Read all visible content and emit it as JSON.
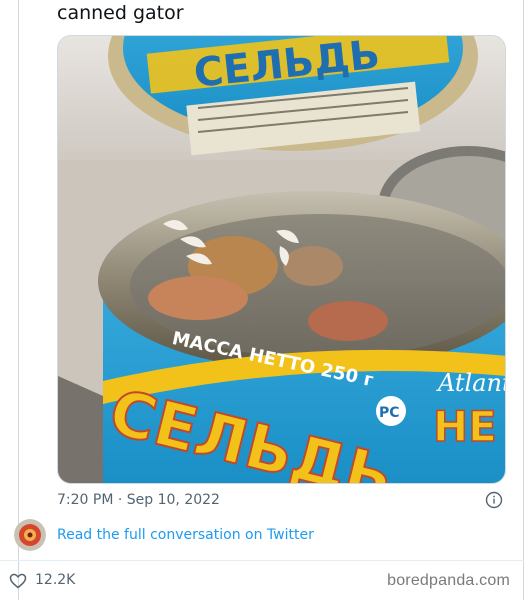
{
  "tweet": {
    "text": "canned gator",
    "timestamp": "7:20 PM · Sep 10, 2022",
    "conversation_link": "Read the full conversation on Twitter",
    "like_count": "12.2K"
  },
  "media": {
    "description_icon": "photo",
    "can_label_top": "СЕЛЬДЬ",
    "can_label_bottom": "СЕЛЬДЬ",
    "mass_label": "МАССА НЕТТО 250 г",
    "brand_right": "Atlant",
    "brand_right_2": "НЕ",
    "rst_mark": "РС"
  },
  "colors": {
    "link": "#1d9bf0",
    "secondary_text": "#536471",
    "border": "#cfd9de",
    "label_blue": "#1f9fd6",
    "label_yellow": "#f2c21a"
  },
  "icons": {
    "info": "info-circle-icon",
    "like": "heart-icon",
    "avatar": "avatar"
  },
  "footer": {
    "watermark": "boredpanda.com"
  }
}
